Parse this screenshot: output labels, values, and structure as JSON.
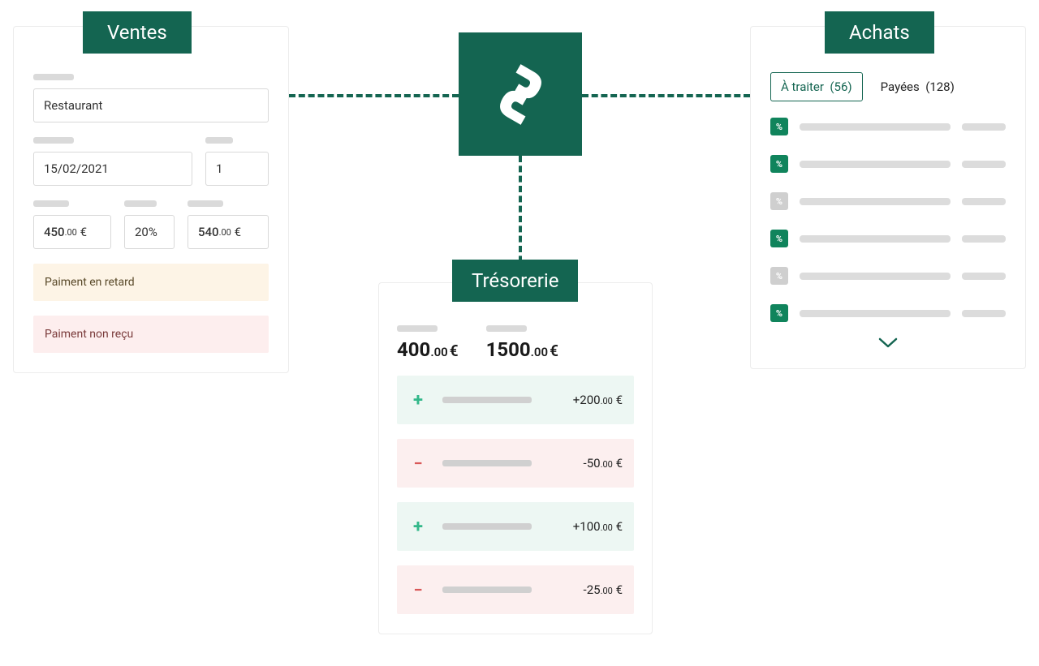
{
  "colors": {
    "primary": "#146551",
    "plus": "#33B88A",
    "minus": "#D95858"
  },
  "ventes": {
    "title": "Ventes",
    "name_value": "Restaurant",
    "date_value": "15/02/2021",
    "qty_value": "1",
    "amount_ht": {
      "int": "450",
      "dec": ".00",
      "cur": "€"
    },
    "vat": "20%",
    "amount_ttc": {
      "int": "540",
      "dec": ".00",
      "cur": "€"
    },
    "status_late": "Paiment en retard",
    "status_notrecv": "Paiment non reçu"
  },
  "tresorerie": {
    "title": "Trésorerie",
    "balance1": {
      "int": "400",
      "dec": ".00",
      "cur": "€"
    },
    "balance2": {
      "int": "1500",
      "dec": ".00",
      "cur": "€"
    },
    "tx": [
      {
        "sign": "+",
        "amt_int": "+200",
        "amt_dec": ".00",
        "cur": "€"
      },
      {
        "sign": "−",
        "amt_int": "-50",
        "amt_dec": ".00",
        "cur": "€"
      },
      {
        "sign": "+",
        "amt_int": "+100",
        "amt_dec": ".00",
        "cur": "€"
      },
      {
        "sign": "−",
        "amt_int": "-25",
        "amt_dec": ".00",
        "cur": "€"
      }
    ]
  },
  "achats": {
    "title": "Achats",
    "tab_active_label": "À traiter",
    "tab_active_count": "(56)",
    "tab_paid_label": "Payées",
    "tab_paid_count": "(128)",
    "rows": [
      {
        "active": true
      },
      {
        "active": true
      },
      {
        "active": false
      },
      {
        "active": true
      },
      {
        "active": false
      },
      {
        "active": true
      }
    ]
  }
}
